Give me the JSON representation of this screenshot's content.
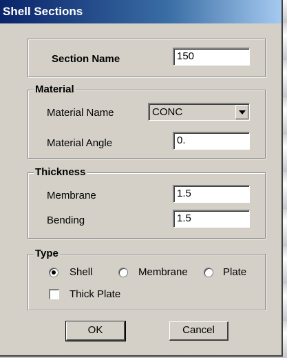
{
  "window": {
    "title": "Shell Sections"
  },
  "section": {
    "label": "Section Name",
    "value": "150"
  },
  "material": {
    "group_label": "Material",
    "name_label": "Material Name",
    "name_value": "CONC",
    "angle_label": "Material Angle",
    "angle_value": "0."
  },
  "thickness": {
    "group_label": "Thickness",
    "membrane_label": "Membrane",
    "membrane_value": "1.5",
    "bending_label": "Bending",
    "bending_value": "1.5"
  },
  "type": {
    "group_label": "Type",
    "options": [
      "Shell",
      "Membrane",
      "Plate"
    ],
    "selected": "Shell",
    "thick_plate_label": "Thick Plate",
    "thick_plate_checked": false
  },
  "buttons": {
    "ok": "OK",
    "cancel": "Cancel"
  }
}
